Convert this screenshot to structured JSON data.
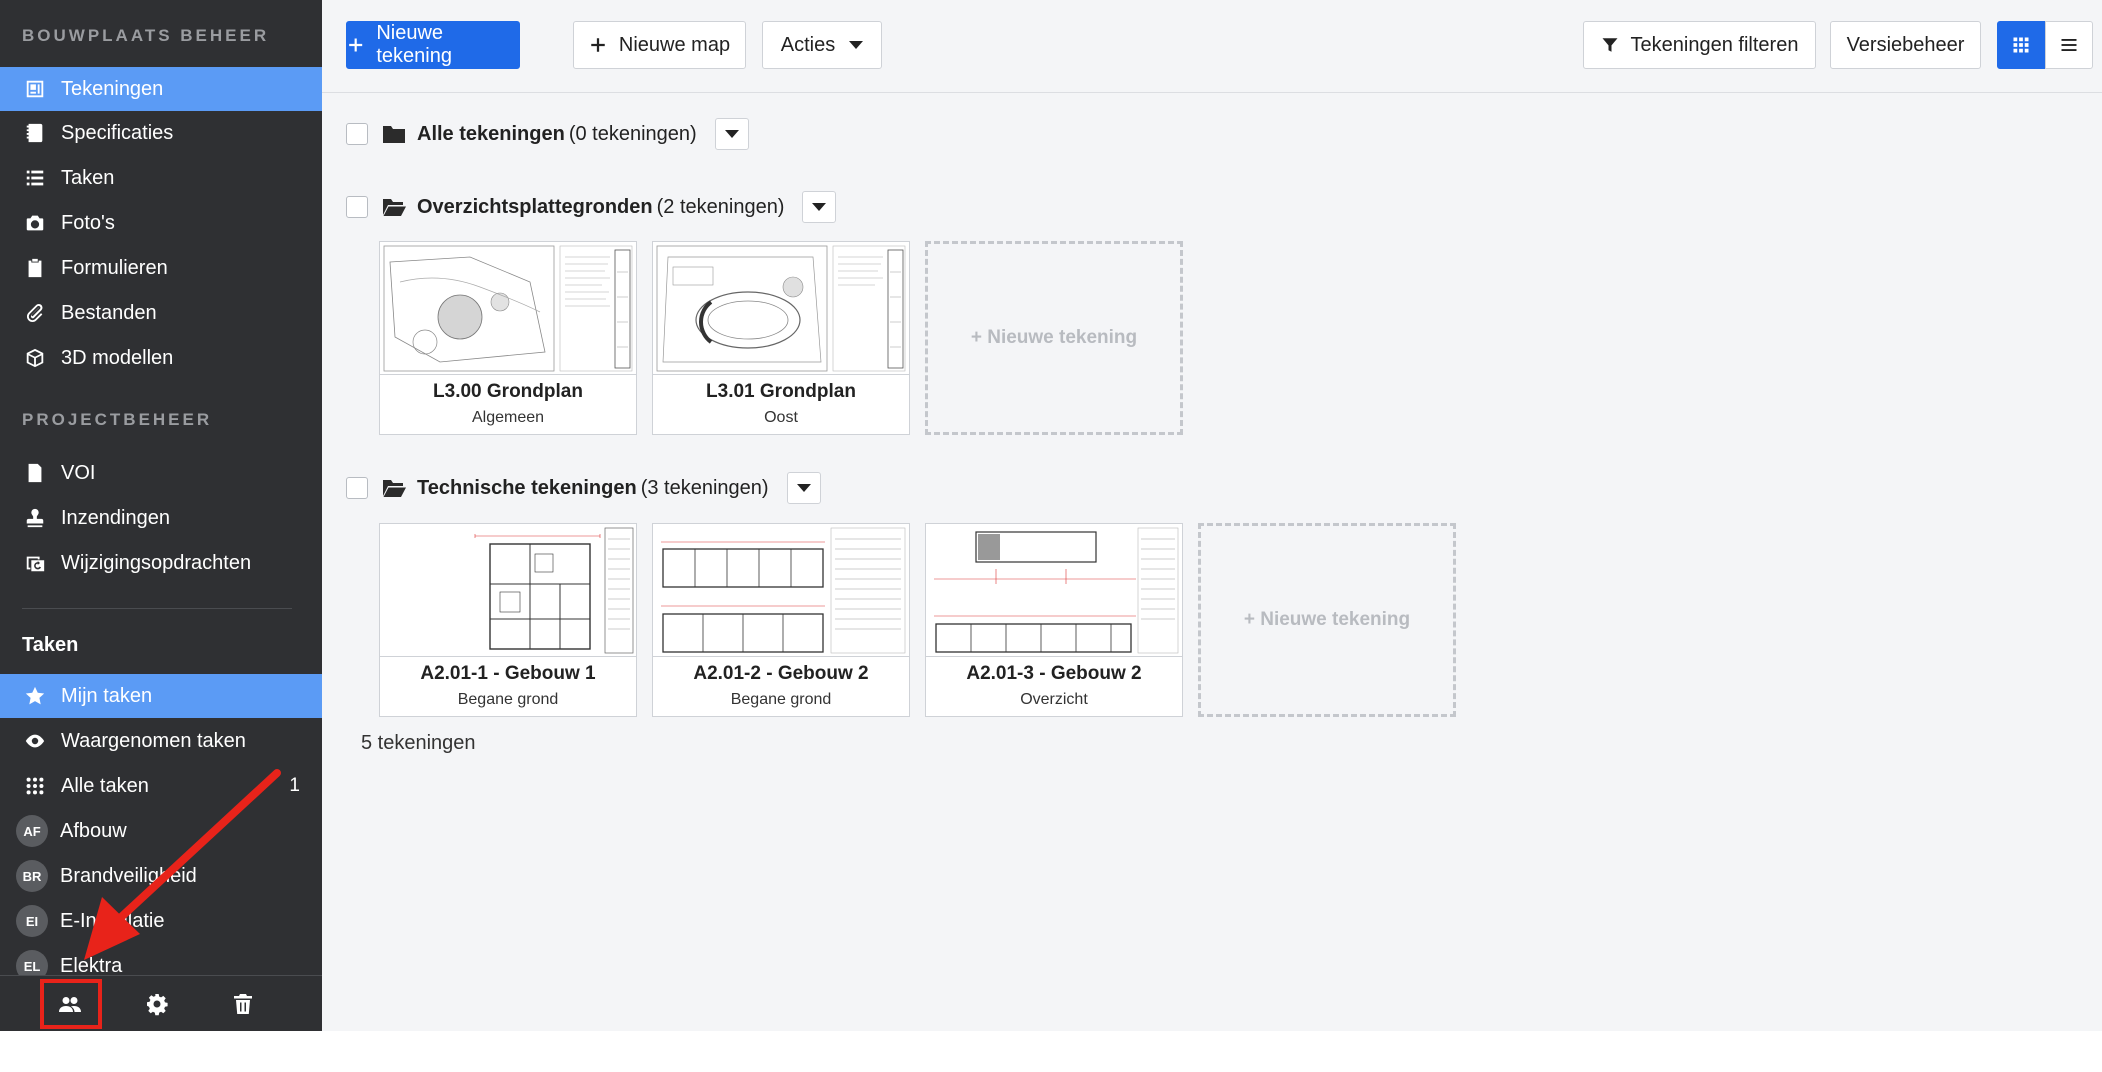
{
  "sidebar": {
    "section1_label": "BOUWPLAATS BEHEER",
    "section1_items": [
      {
        "label": "Tekeningen",
        "icon": "drawings-icon"
      },
      {
        "label": "Specificaties",
        "icon": "specs-book-icon"
      },
      {
        "label": "Taken",
        "icon": "list-icon"
      },
      {
        "label": "Foto's",
        "icon": "camera-icon"
      },
      {
        "label": "Formulieren",
        "icon": "clipboard-icon"
      },
      {
        "label": "Bestanden",
        "icon": "paperclip-icon"
      },
      {
        "label": "3D modellen",
        "icon": "cube-icon"
      }
    ],
    "section2_label": "PROJECTBEHEER",
    "section2_items": [
      {
        "label": "VOI",
        "icon": "info-document-icon"
      },
      {
        "label": "Inzendingen",
        "icon": "stamp-icon"
      },
      {
        "label": "Wijzigingsopdrachten",
        "icon": "change-order-icon"
      }
    ],
    "taken_heading": "Taken",
    "taken_items": [
      {
        "label": "Mijn taken",
        "icon": "star-icon"
      },
      {
        "label": "Waargenomen taken",
        "icon": "eye-icon"
      },
      {
        "label": "Alle taken",
        "icon": "grid-dots-icon",
        "count": "1"
      }
    ],
    "groups": [
      {
        "initials": "AF",
        "label": "Afbouw"
      },
      {
        "initials": "BR",
        "label": "Brandveiligheid"
      },
      {
        "initials": "EI",
        "label": "E-Installatie"
      },
      {
        "initials": "EL",
        "label": "Elektra"
      }
    ],
    "footer_icons": [
      "users-icon",
      "gear-icon",
      "trash-icon"
    ]
  },
  "toolbar": {
    "new_drawing": "Nieuwe tekening",
    "new_folder": "Nieuwe map",
    "actions": "Acties",
    "filter": "Tekeningen filteren",
    "versions": "Versiebeheer"
  },
  "folders": [
    {
      "name": "Alle tekeningen",
      "count": "(0 tekeningen)"
    },
    {
      "name": "Overzichtsplattegronden",
      "count": "(2 tekeningen)"
    },
    {
      "name": "Technische tekeningen",
      "count": "(3 tekeningen)"
    }
  ],
  "cards": {
    "overzicht": [
      {
        "title": "L3.00 Grondplan",
        "sub": "Algemeen"
      },
      {
        "title": "L3.01 Grondplan",
        "sub": "Oost"
      }
    ],
    "technisch": [
      {
        "title": "A2.01-1 - Gebouw 1",
        "sub": "Begane grond"
      },
      {
        "title": "A2.01-2 - Gebouw 2",
        "sub": "Begane grond"
      },
      {
        "title": "A2.01-3 - Gebouw 2",
        "sub": "Overzicht"
      }
    ],
    "new_label": "+ Nieuwe tekening"
  },
  "summary": "5 tekeningen",
  "colors": {
    "sidebar_bg": "#2f3033",
    "active_item": "#5b9bf5",
    "primary": "#1f6ae8",
    "annotation": "#e8231a"
  }
}
